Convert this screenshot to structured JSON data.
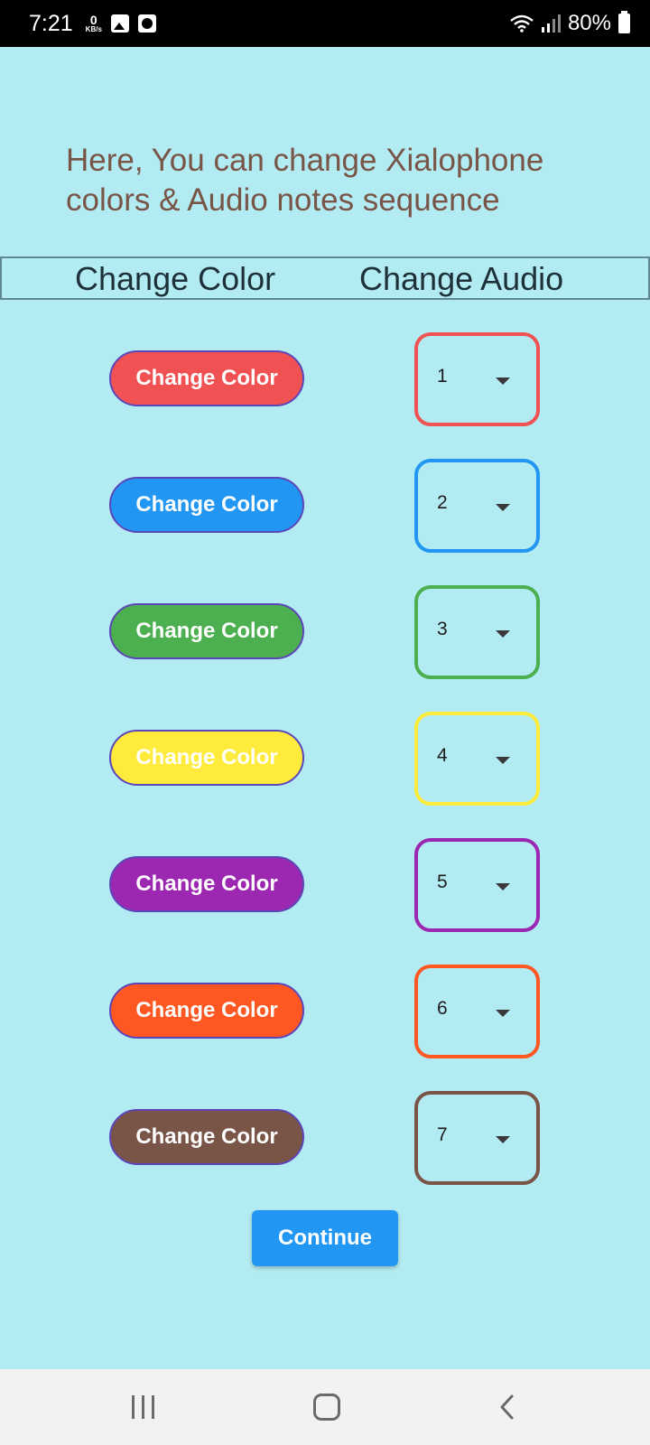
{
  "status_bar": {
    "time": "7:21",
    "net_speed_value": "0",
    "net_speed_unit": "KB/s",
    "battery": "80%"
  },
  "screen": {
    "heading": "Here, You can change Xialophone colors & Audio notes sequence",
    "header": {
      "change_color": "Change Color",
      "change_audio": "Change Audio"
    },
    "rows": [
      {
        "button_label": "Change Color",
        "audio_value": "1",
        "color": "#f05152"
      },
      {
        "button_label": "Change Color",
        "audio_value": "2",
        "color": "#2196f3"
      },
      {
        "button_label": "Change Color",
        "audio_value": "3",
        "color": "#4caf50"
      },
      {
        "button_label": "Change Color",
        "audio_value": "4",
        "color": "#ffeb3b"
      },
      {
        "button_label": "Change Color",
        "audio_value": "5",
        "color": "#9c27b0"
      },
      {
        "button_label": "Change Color",
        "audio_value": "6",
        "color": "#ff5722"
      },
      {
        "button_label": "Change Color",
        "audio_value": "7",
        "color": "#795548"
      }
    ],
    "continue_label": "Continue"
  },
  "colors": {
    "background": "#b3ebf2",
    "heading": "#795548",
    "continue": "#2196f3"
  }
}
